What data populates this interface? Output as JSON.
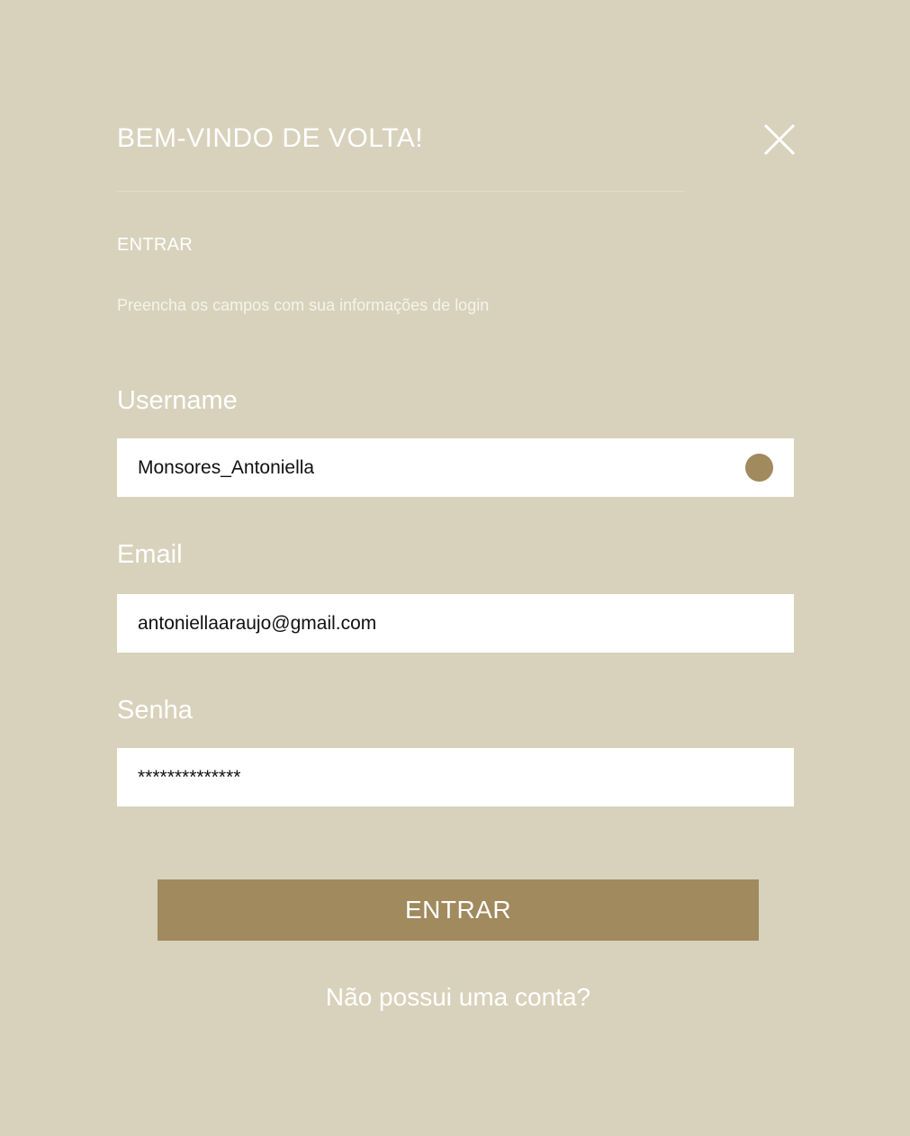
{
  "modal": {
    "title": "BEM-VINDO DE VOLTA!",
    "close_icon": "close-icon",
    "section_label": "ENTRAR",
    "helper_text": "Preencha os campos com sua informações de login"
  },
  "form": {
    "username": {
      "label": "Username",
      "value": "Monsores_Antoniella",
      "status_color": "#a08a5e"
    },
    "email": {
      "label": "Email",
      "value": "antoniellaaraujo@gmail.com"
    },
    "password": {
      "label": "Senha",
      "value": "**************"
    },
    "submit_label": "ENTRAR",
    "signup_link": "Não possui uma conta?"
  },
  "colors": {
    "background": "#d8d2bc",
    "accent": "#a08a5e",
    "field_background": "#ffffff",
    "text": "#ffffff"
  }
}
